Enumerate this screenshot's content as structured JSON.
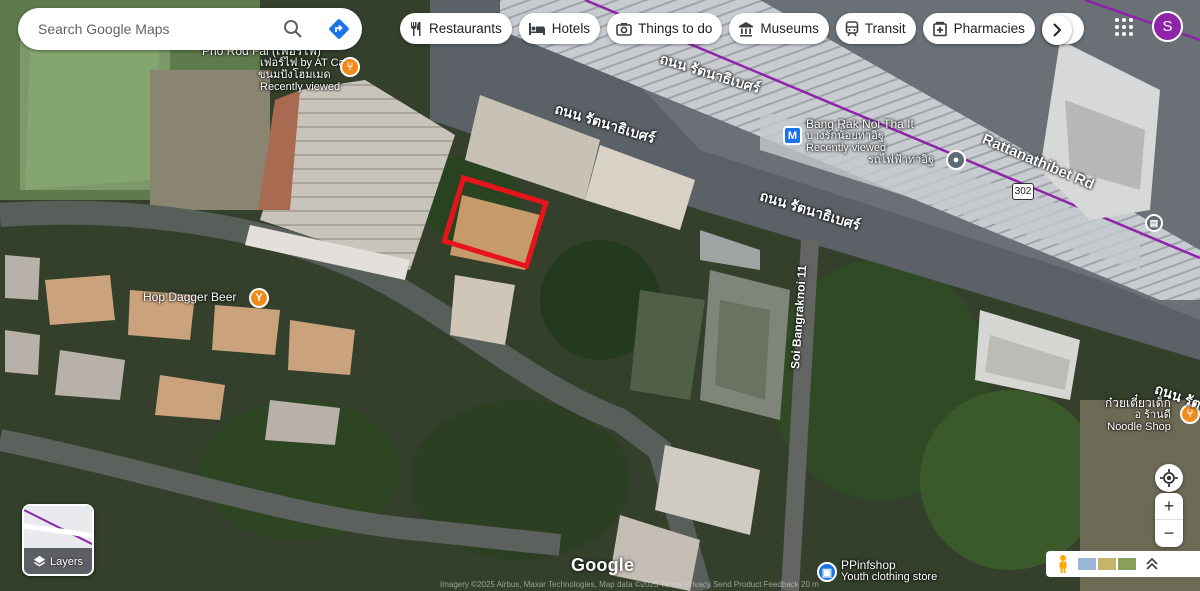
{
  "search": {
    "placeholder": "Search Google Maps"
  },
  "chips": [
    {
      "label": "Restaurants",
      "icon": "fork-knife-icon"
    },
    {
      "label": "Hotels",
      "icon": "bed-icon"
    },
    {
      "label": "Things to do",
      "icon": "camera-icon"
    },
    {
      "label": "Museums",
      "icon": "museum-icon"
    },
    {
      "label": "Transit",
      "icon": "train-icon"
    },
    {
      "label": "Pharmacies",
      "icon": "pharmacy-icon"
    }
  ],
  "account": {
    "initial": "S",
    "color": "#8e24aa"
  },
  "places": {
    "pho_rod_fai": {
      "name": "Pho Rod Fai (เฟอร์ไฟ)",
      "line2": "เฟอร์ไฟ by AT Cafe",
      "line3": "ขนมปังโฮมเมด",
      "status": "Recently viewed"
    },
    "bang_rak_noi": {
      "name": "Bang Rak Noi Tha It",
      "line2": "บางรักน้อยท่าอิฐ",
      "status": "Recently viewed",
      "line3": "รถไฟฟ้าท่าอิฐ"
    },
    "hop_dagger": {
      "name": "Hop Dagger Beer"
    },
    "noodle_shop": {
      "name": "ก๋วยเตี๋ยวเด็ก",
      "line2": "อ ร้านดี",
      "line3": "Noodle Shop"
    },
    "ppinfshop": {
      "name": "PPinfshop",
      "sub": "Youth clothing store"
    }
  },
  "roads": {
    "thai1": "ถนน รัตนาธิเบศร์",
    "thai2": "ถนน รัตนาธิเบศร์",
    "thai3": "ถนน รัตนาธิเบศร์",
    "thai4": "ถนน รัตนาธิเบศร์",
    "rattanathibet": "Rattanathibet Rd",
    "soi": "Soi Bangraknoi 11",
    "shield": "302"
  },
  "controls": {
    "layers_label": "Layers",
    "zoom_in": "+",
    "zoom_out": "−"
  },
  "branding": {
    "logo": "Google",
    "footer": "Imagery ©2025 Airbus, Maxar Technologies, Map data ©2025 Terms Privacy Send Product Feedback 20 m"
  },
  "colors": {
    "highlight": "#e8141b",
    "transit_line": "#8e24aa",
    "restaurant_pin": "#f28b1c",
    "metro_pin": "#1a73e8"
  }
}
